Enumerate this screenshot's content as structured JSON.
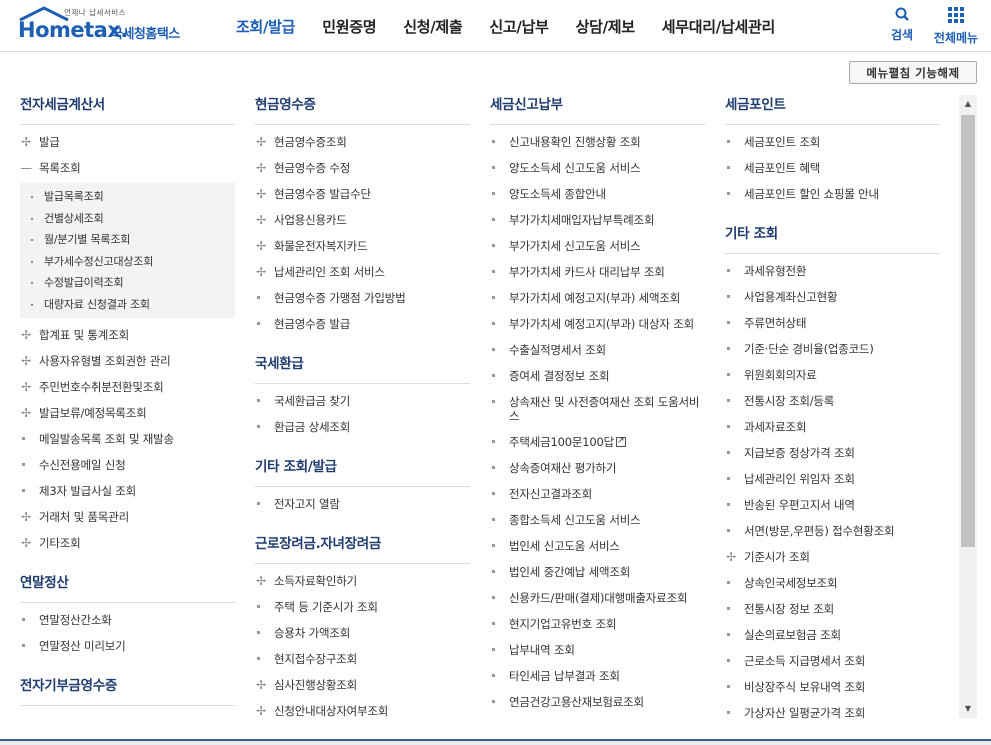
{
  "header": {
    "tagline": "언제나 납세서비스",
    "brand": "Hometax.",
    "brand_sub": "국세청홈택스",
    "nav": [
      "조회/발급",
      "민원증명",
      "신청/제출",
      "신고/납부",
      "상담/제보",
      "세무대리/납세관리"
    ],
    "search_label": "검색",
    "all_menu_label": "전체메뉴"
  },
  "toggle_button": "메뉴펼침 기능해제",
  "columns": [
    {
      "sections": [
        {
          "title": "전자세금계산서",
          "items": [
            {
              "label": "발급",
              "marker": "plus"
            },
            {
              "label": "목록조회",
              "marker": "minus",
              "sub": [
                "발급목록조회",
                "건별상세조회",
                "월/분기별 목록조회",
                "부가세수정신고대상조회",
                "수정발급이력조회",
                "대량자료 신청결과 조회"
              ]
            },
            {
              "label": "합계표 및 통계조회",
              "marker": "plus"
            },
            {
              "label": "사용자유형별 조회권한 관리",
              "marker": "plus"
            },
            {
              "label": "주민번호수취분전환및조회",
              "marker": "plus"
            },
            {
              "label": "발급보류/예정목록조회",
              "marker": "plus"
            },
            {
              "label": "메일발송목록 조회 및 재발송",
              "marker": "dot"
            },
            {
              "label": "수신전용메일 신청",
              "marker": "dot"
            },
            {
              "label": "제3자 발급사실 조회",
              "marker": "dot"
            },
            {
              "label": "거래처 및 품목관리",
              "marker": "plus"
            },
            {
              "label": "기타조회",
              "marker": "plus"
            }
          ]
        },
        {
          "title": "연말정산",
          "items": [
            {
              "label": "연말정산간소화",
              "marker": "dot"
            },
            {
              "label": "연말정산 미리보기",
              "marker": "dot"
            }
          ]
        },
        {
          "title": "전자기부금영수증",
          "items": []
        }
      ]
    },
    {
      "sections": [
        {
          "title": "현금영수증",
          "items": [
            {
              "label": "현금영수증조회",
              "marker": "plus"
            },
            {
              "label": "현금영수증 수정",
              "marker": "plus"
            },
            {
              "label": "현금영수증 발급수단",
              "marker": "plus"
            },
            {
              "label": "사업용신용카드",
              "marker": "plus"
            },
            {
              "label": "화물운전자복지카드",
              "marker": "plus"
            },
            {
              "label": "납세관리인 조회 서비스",
              "marker": "plus"
            },
            {
              "label": "현금영수증 가맹점 가입방법",
              "marker": "dot"
            },
            {
              "label": "현금영수증 발급",
              "marker": "dot"
            }
          ]
        },
        {
          "title": "국세환급",
          "items": [
            {
              "label": "국세환급금 찾기",
              "marker": "dot"
            },
            {
              "label": "환급금 상세조회",
              "marker": "dot"
            }
          ]
        },
        {
          "title": "기타 조회/발급",
          "items": [
            {
              "label": "전자고지 열람",
              "marker": "dot"
            }
          ]
        },
        {
          "title": "근로장려금.자녀장려금",
          "items": [
            {
              "label": "소득자료확인하기",
              "marker": "plus"
            },
            {
              "label": "주택 등 기준시가 조회",
              "marker": "dot"
            },
            {
              "label": "승용차 가액조회",
              "marker": "dot"
            },
            {
              "label": "현지접수장구조회",
              "marker": "dot"
            },
            {
              "label": "심사진행상황조회",
              "marker": "plus"
            },
            {
              "label": "신청안내대상자여부조회",
              "marker": "plus"
            }
          ]
        }
      ]
    },
    {
      "sections": [
        {
          "title": "세금신고납부",
          "items": [
            {
              "label": "신고내용확인 진행상황 조회",
              "marker": "dot"
            },
            {
              "label": "양도소득세 신고도움 서비스",
              "marker": "dot"
            },
            {
              "label": "양도소득세 종합안내",
              "marker": "dot"
            },
            {
              "label": "부가가치세매입자납부특례조회",
              "marker": "dot"
            },
            {
              "label": "부가가치세 신고도움 서비스",
              "marker": "dot"
            },
            {
              "label": "부가가치세 카드사 대리납부 조회",
              "marker": "dot"
            },
            {
              "label": "부가가치세 예정고지(부과) 세액조회",
              "marker": "dot"
            },
            {
              "label": "부가가치세 예정고지(부과) 대상자 조회",
              "marker": "dot"
            },
            {
              "label": "수출실적명세서 조회",
              "marker": "dot"
            },
            {
              "label": "증여세 결정정보 조회",
              "marker": "dot"
            },
            {
              "label": "상속재산 및 사전증여재산 조회 도움서비스",
              "marker": "dot"
            },
            {
              "label": "주택세금100문100답",
              "marker": "dot",
              "external": true
            },
            {
              "label": "상속증여재산 평가하기",
              "marker": "dot"
            },
            {
              "label": "전자신고결과조회",
              "marker": "dot"
            },
            {
              "label": "종합소득세 신고도움 서비스",
              "marker": "dot"
            },
            {
              "label": "법인세 신고도움 서비스",
              "marker": "dot"
            },
            {
              "label": "법인세 중간예납 세액조회",
              "marker": "dot"
            },
            {
              "label": "신용카드/판매(결제)대행매출자료조회",
              "marker": "dot"
            },
            {
              "label": "현지기업고유번호 조회",
              "marker": "dot"
            },
            {
              "label": "납부내역 조회",
              "marker": "dot"
            },
            {
              "label": "타인세금 납부결과 조회",
              "marker": "dot"
            },
            {
              "label": "연금건강고용산재보험료조회",
              "marker": "dot"
            }
          ]
        }
      ]
    },
    {
      "sections": [
        {
          "title": "세금포인트",
          "items": [
            {
              "label": "세금포인트 조회",
              "marker": "dot"
            },
            {
              "label": "세금포인트 혜택",
              "marker": "dot"
            },
            {
              "label": "세금포인트 할인 쇼핑몰 안내",
              "marker": "dot"
            }
          ]
        },
        {
          "title": "기타 조회",
          "items": [
            {
              "label": "과세유형전환",
              "marker": "dot"
            },
            {
              "label": "사업용계좌신고현황",
              "marker": "dot"
            },
            {
              "label": "주류면허상태",
              "marker": "dot"
            },
            {
              "label": "기준·단순 경비율(업종코드)",
              "marker": "dot"
            },
            {
              "label": "위원회회의자료",
              "marker": "dot"
            },
            {
              "label": "전통시장 조회/등록",
              "marker": "dot"
            },
            {
              "label": "과세자료조회",
              "marker": "dot"
            },
            {
              "label": "지급보증 정상가격 조회",
              "marker": "dot"
            },
            {
              "label": "납세관리인 위임자 조회",
              "marker": "dot"
            },
            {
              "label": "반송된 우편고지서 내역",
              "marker": "dot"
            },
            {
              "label": "서면(방문,우편등) 접수현황조회",
              "marker": "dot"
            },
            {
              "label": "기준시가 조회",
              "marker": "plus"
            },
            {
              "label": "상속인국세정보조회",
              "marker": "dot"
            },
            {
              "label": "전통시장 정보 조회",
              "marker": "dot"
            },
            {
              "label": "실손의료보험금 조회",
              "marker": "dot"
            },
            {
              "label": "근로소득 지급명세서 조회",
              "marker": "dot"
            },
            {
              "label": "비상장주식 보유내역 조회",
              "marker": "dot"
            },
            {
              "label": "가상자산 일평균가격 조회",
              "marker": "dot"
            }
          ]
        }
      ]
    }
  ],
  "colors": {
    "brand_blue": "#1f5fb3",
    "active_nav": "#1c5fb7",
    "section_title": "#1f3c6e"
  }
}
